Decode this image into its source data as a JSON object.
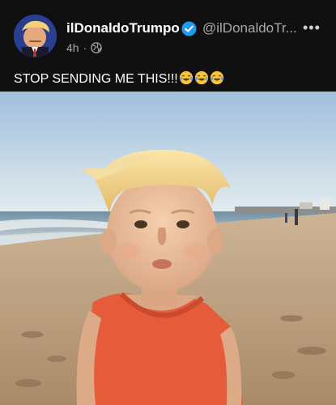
{
  "post": {
    "display_name": "ilDonaldoTrumpo",
    "handle": "@ilDonaldoTr...",
    "timestamp": "4h",
    "separator": "·",
    "text": "STOP SENDING ME THIS!!!",
    "emoji": [
      "face-with-tears-of-joy-icon",
      "face-with-tears-of-joy-icon",
      "face-with-tears-of-joy-icon"
    ],
    "more_label": "•••",
    "image_description": "toddler with blond swept hair on a beach"
  },
  "colors": {
    "background": "#101010",
    "handle_gray": "#a9a9a9",
    "verified_blue": "#1d9bf0"
  }
}
